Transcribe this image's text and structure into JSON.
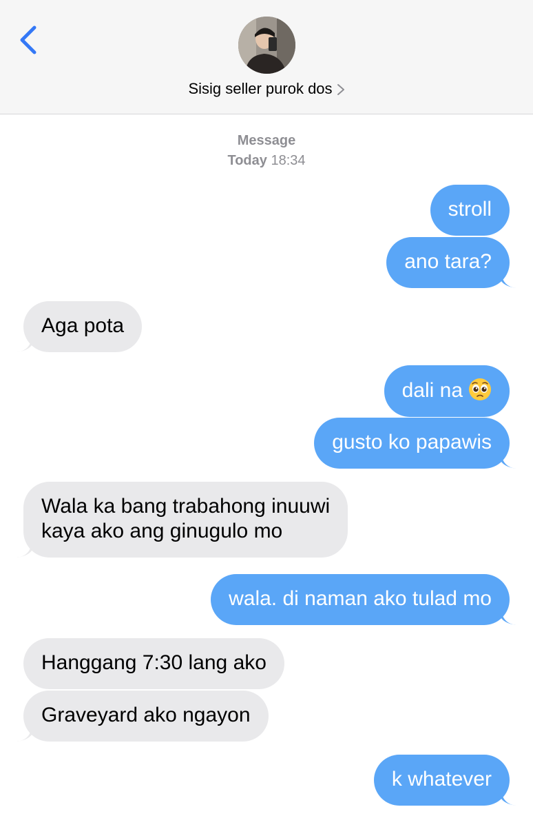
{
  "header": {
    "contact_name": "Sisig seller purok dos",
    "avatar_icon": "avatar-photo"
  },
  "meta": {
    "service": "Message",
    "day": "Today",
    "time": "18:34"
  },
  "colors": {
    "sent_bubble": "#5aa6f7",
    "received_bubble": "#e9e9eb",
    "accent": "#3478f6"
  },
  "messages": [
    {
      "dir": "out",
      "text": "stroll"
    },
    {
      "dir": "out",
      "text": "ano tara?"
    },
    {
      "dir": "in",
      "text": "Aga pota"
    },
    {
      "dir": "out",
      "text": "dali na",
      "emoji": "pleading-face-icon"
    },
    {
      "dir": "out",
      "text": "gusto ko papawis"
    },
    {
      "dir": "in",
      "line1": "Wala ka bang trabahong inuuwi",
      "line2": "kaya ako ang ginugulo mo"
    },
    {
      "dir": "out",
      "text": "wala. di naman ako tulad mo"
    },
    {
      "dir": "in",
      "text": "Hanggang 7:30 lang ako"
    },
    {
      "dir": "in",
      "text": "Graveyard ako ngayon"
    },
    {
      "dir": "out",
      "text": "k whatever"
    }
  ]
}
